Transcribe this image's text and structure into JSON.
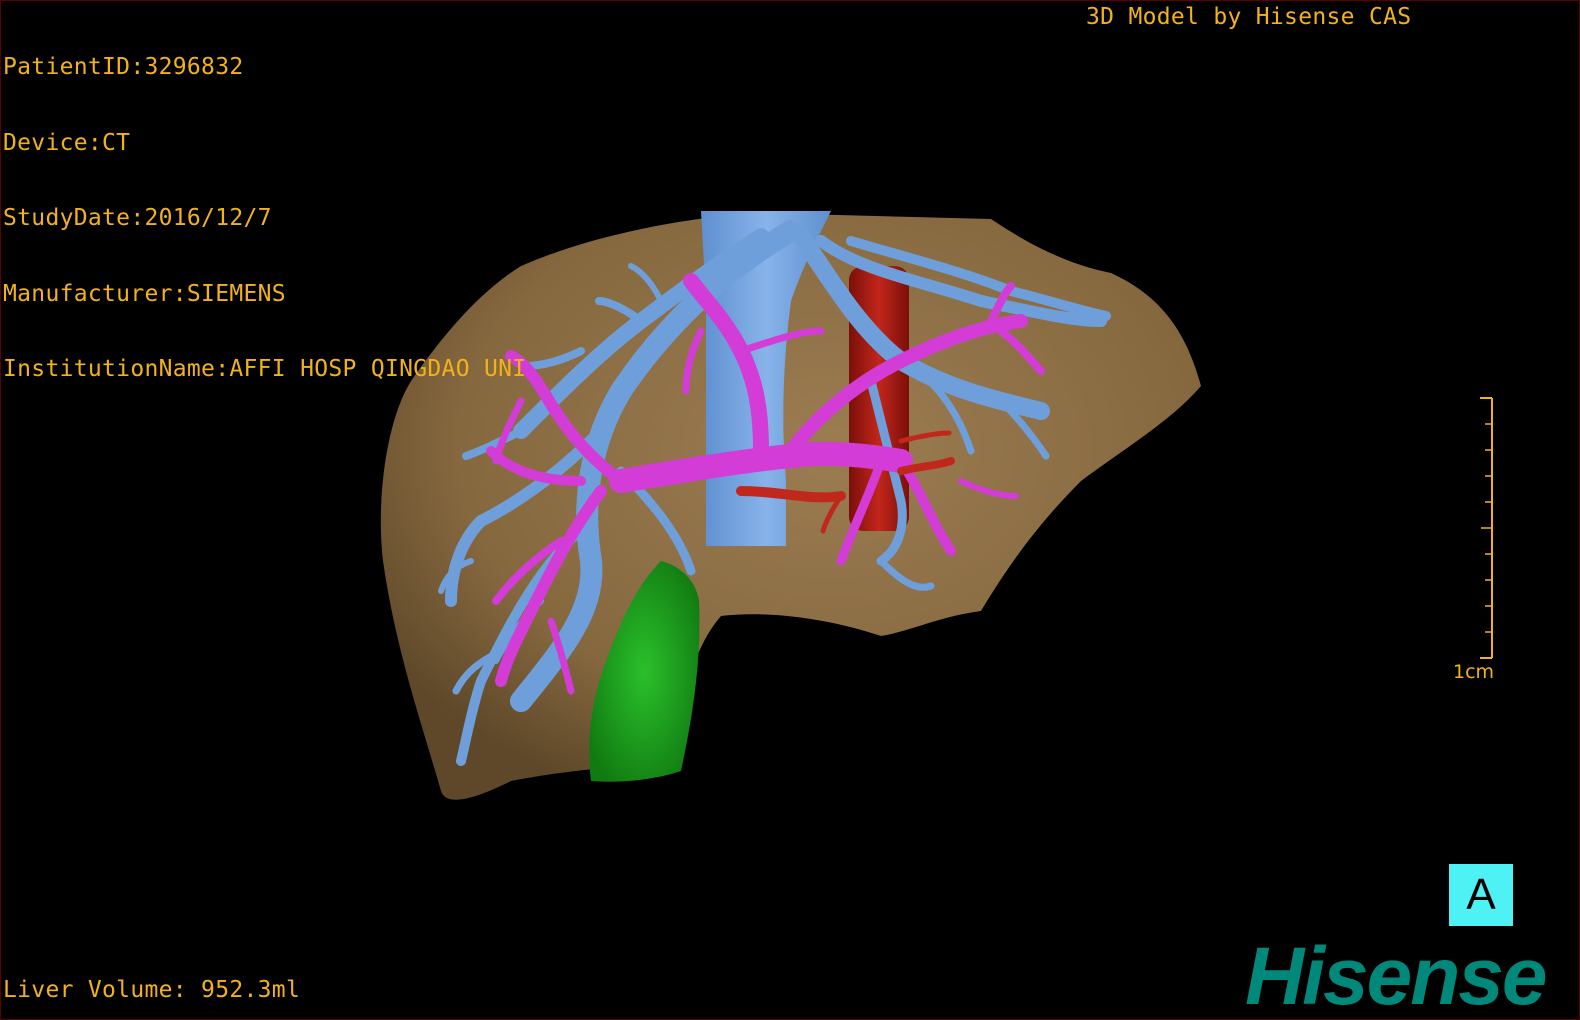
{
  "study": {
    "patient_id": "PatientID:3296832",
    "device": "Device:CT",
    "study_date": "StudyDate:2016/12/7",
    "manufacturer": "Manufacturer:SIEMENS",
    "institution": "InstitutionName:AFFI HOSP QINGDAO UNI"
  },
  "header": {
    "model_credit": "3D Model by Hisense CAS"
  },
  "footer": {
    "liver_volume": "Liver Volume: 952.3ml"
  },
  "scale_bar": {
    "label": "1cm",
    "ticks": 10
  },
  "orientation": {
    "label": "A"
  },
  "brand": {
    "name": "Hisense"
  },
  "colors": {
    "background": "#000000",
    "overlay_text": "#f2b21c",
    "liver": "#8f7048",
    "hepatic_veins": "#6f9fdb",
    "portal_vein": "#d33cd6",
    "artery": "#a81a12",
    "gallbladder": "#1fa31f",
    "orientation_cube": "#4ef1f4",
    "brand": "#00897a"
  }
}
